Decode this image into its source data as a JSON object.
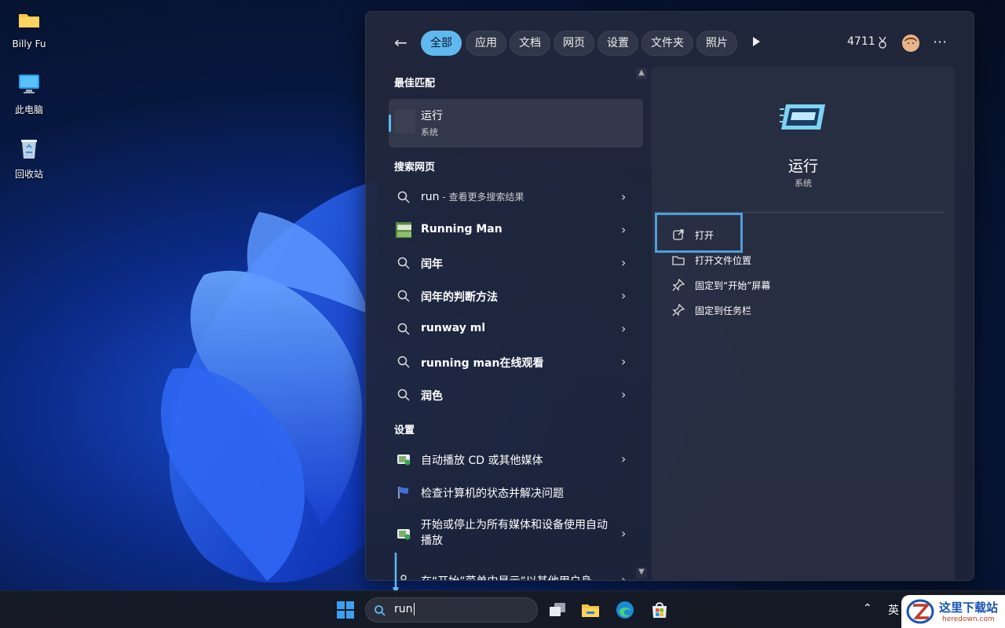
{
  "desktop": {
    "icons": [
      {
        "label": "Billy Fu",
        "icon": "folder-icon"
      },
      {
        "label": "此电脑",
        "icon": "computer-icon"
      },
      {
        "label": "回收站",
        "icon": "recycle-bin-icon"
      }
    ]
  },
  "search_panel": {
    "tabs": [
      "全部",
      "应用",
      "文档",
      "网页",
      "设置",
      "文件夹",
      "照片"
    ],
    "active_tab": "全部",
    "points": "4711",
    "best_match": {
      "heading": "最佳匹配",
      "title": "运行",
      "subtitle": "系统"
    },
    "web": {
      "heading": "搜索网页",
      "items": [
        {
          "text": "run",
          "suffix": " - 查看更多搜索结果"
        },
        {
          "text": "Running Man"
        },
        {
          "text": "闰年"
        },
        {
          "text": "闰年的判断方法"
        },
        {
          "text": "runway ml"
        },
        {
          "text": "running man在线观看"
        },
        {
          "text": "润色"
        }
      ]
    },
    "settings": {
      "heading": "设置",
      "items": [
        {
          "text": "自动播放 CD 或其他媒体"
        },
        {
          "text": "检查计算机的状态并解决问题"
        },
        {
          "text": "开始或停止为所有媒体和设备使用自动播放"
        },
        {
          "text": "在“开始”菜单中显示”以其他用户身"
        }
      ]
    },
    "preview": {
      "title": "运行",
      "subtitle": "系统",
      "actions": [
        "打开",
        "打开文件位置",
        "固定到“开始”屏幕",
        "固定到任务栏"
      ]
    }
  },
  "taskbar": {
    "search_value": "run",
    "language": "英"
  },
  "watermark": {
    "title": "这里下载站",
    "url": "heredown.com"
  },
  "colors": {
    "accent": "#5fb8ef",
    "highlight_box": "#4e9fd9"
  }
}
